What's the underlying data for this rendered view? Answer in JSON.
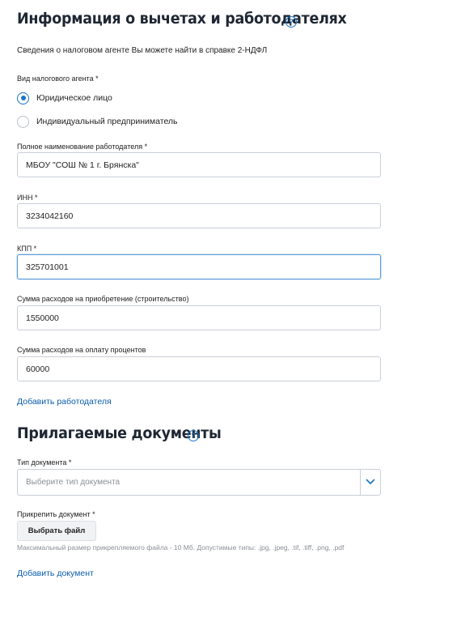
{
  "deductions": {
    "title": "Информация о вычетах и работодателях",
    "help_symbol": "?",
    "note": "Сведения о налоговом агенте Вы можете найти в справке 2-НДФЛ",
    "agent_type": {
      "label": "Вид налогового агента *",
      "options": [
        {
          "label": "Юридическое лицо",
          "selected": true
        },
        {
          "label": "Индивидуальный предприниматель",
          "selected": false
        }
      ]
    },
    "employer_name": {
      "label": "Полное наименование работодателя *",
      "value": "МБОУ \"СОШ № 1 г. Брянска\""
    },
    "inn": {
      "label": "ИНН *",
      "value": "3234042160"
    },
    "kpp": {
      "label": "КПП *",
      "value": "325701001"
    },
    "purchase_expenses": {
      "label": "Сумма расходов на приобретение (строительство)",
      "value": "1550000"
    },
    "interest_expenses": {
      "label": "Сумма расходов на оплату процентов",
      "value": "60000"
    },
    "add_employer_link": "Добавить работодателя"
  },
  "documents": {
    "title": "Прилагаемые документы",
    "help_symbol": "?",
    "doc_type": {
      "label": "Тип документа *",
      "placeholder": "Выберите тип документа"
    },
    "attach": {
      "label": "Прикрепить документ *",
      "button_label": "Выбрать файл",
      "hint": "Максимальный размер прикрепляемого файла - 10 Мб. Допустимые типы: .jpg, .jpeg, .tif, .tiff, .png, .pdf"
    },
    "add_document_link": "Добавить документ"
  },
  "colors": {
    "accent": "#1a73c7",
    "link": "#0b5cad",
    "border": "#c9ced6",
    "focus_border": "#5a9bd8",
    "hint_text": "#8a8f96"
  },
  "icons": [
    "help-icon",
    "chevron-down-icon"
  ]
}
